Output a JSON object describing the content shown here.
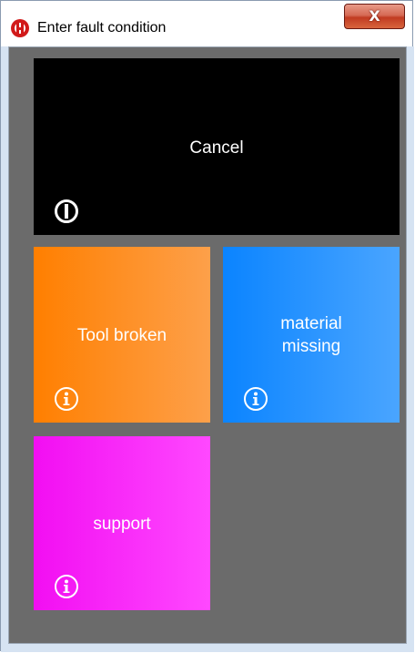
{
  "window": {
    "title": "Enter fault condition",
    "close_glyph": "X"
  },
  "tiles": [
    {
      "label": "Cancel",
      "icon": "power-icon",
      "color": "#000000"
    },
    {
      "label": "Tool broken",
      "icon": "info-icon",
      "color": "#ff8a1a"
    },
    {
      "label_lines": [
        "material",
        "missing"
      ],
      "icon": "info-icon",
      "color": "#1e8cff"
    },
    {
      "label": "support",
      "icon": "info-icon",
      "color": "#f52cf5"
    }
  ],
  "colors": {
    "client_background": "#6b6b6b",
    "close_button": "#c9452b"
  }
}
